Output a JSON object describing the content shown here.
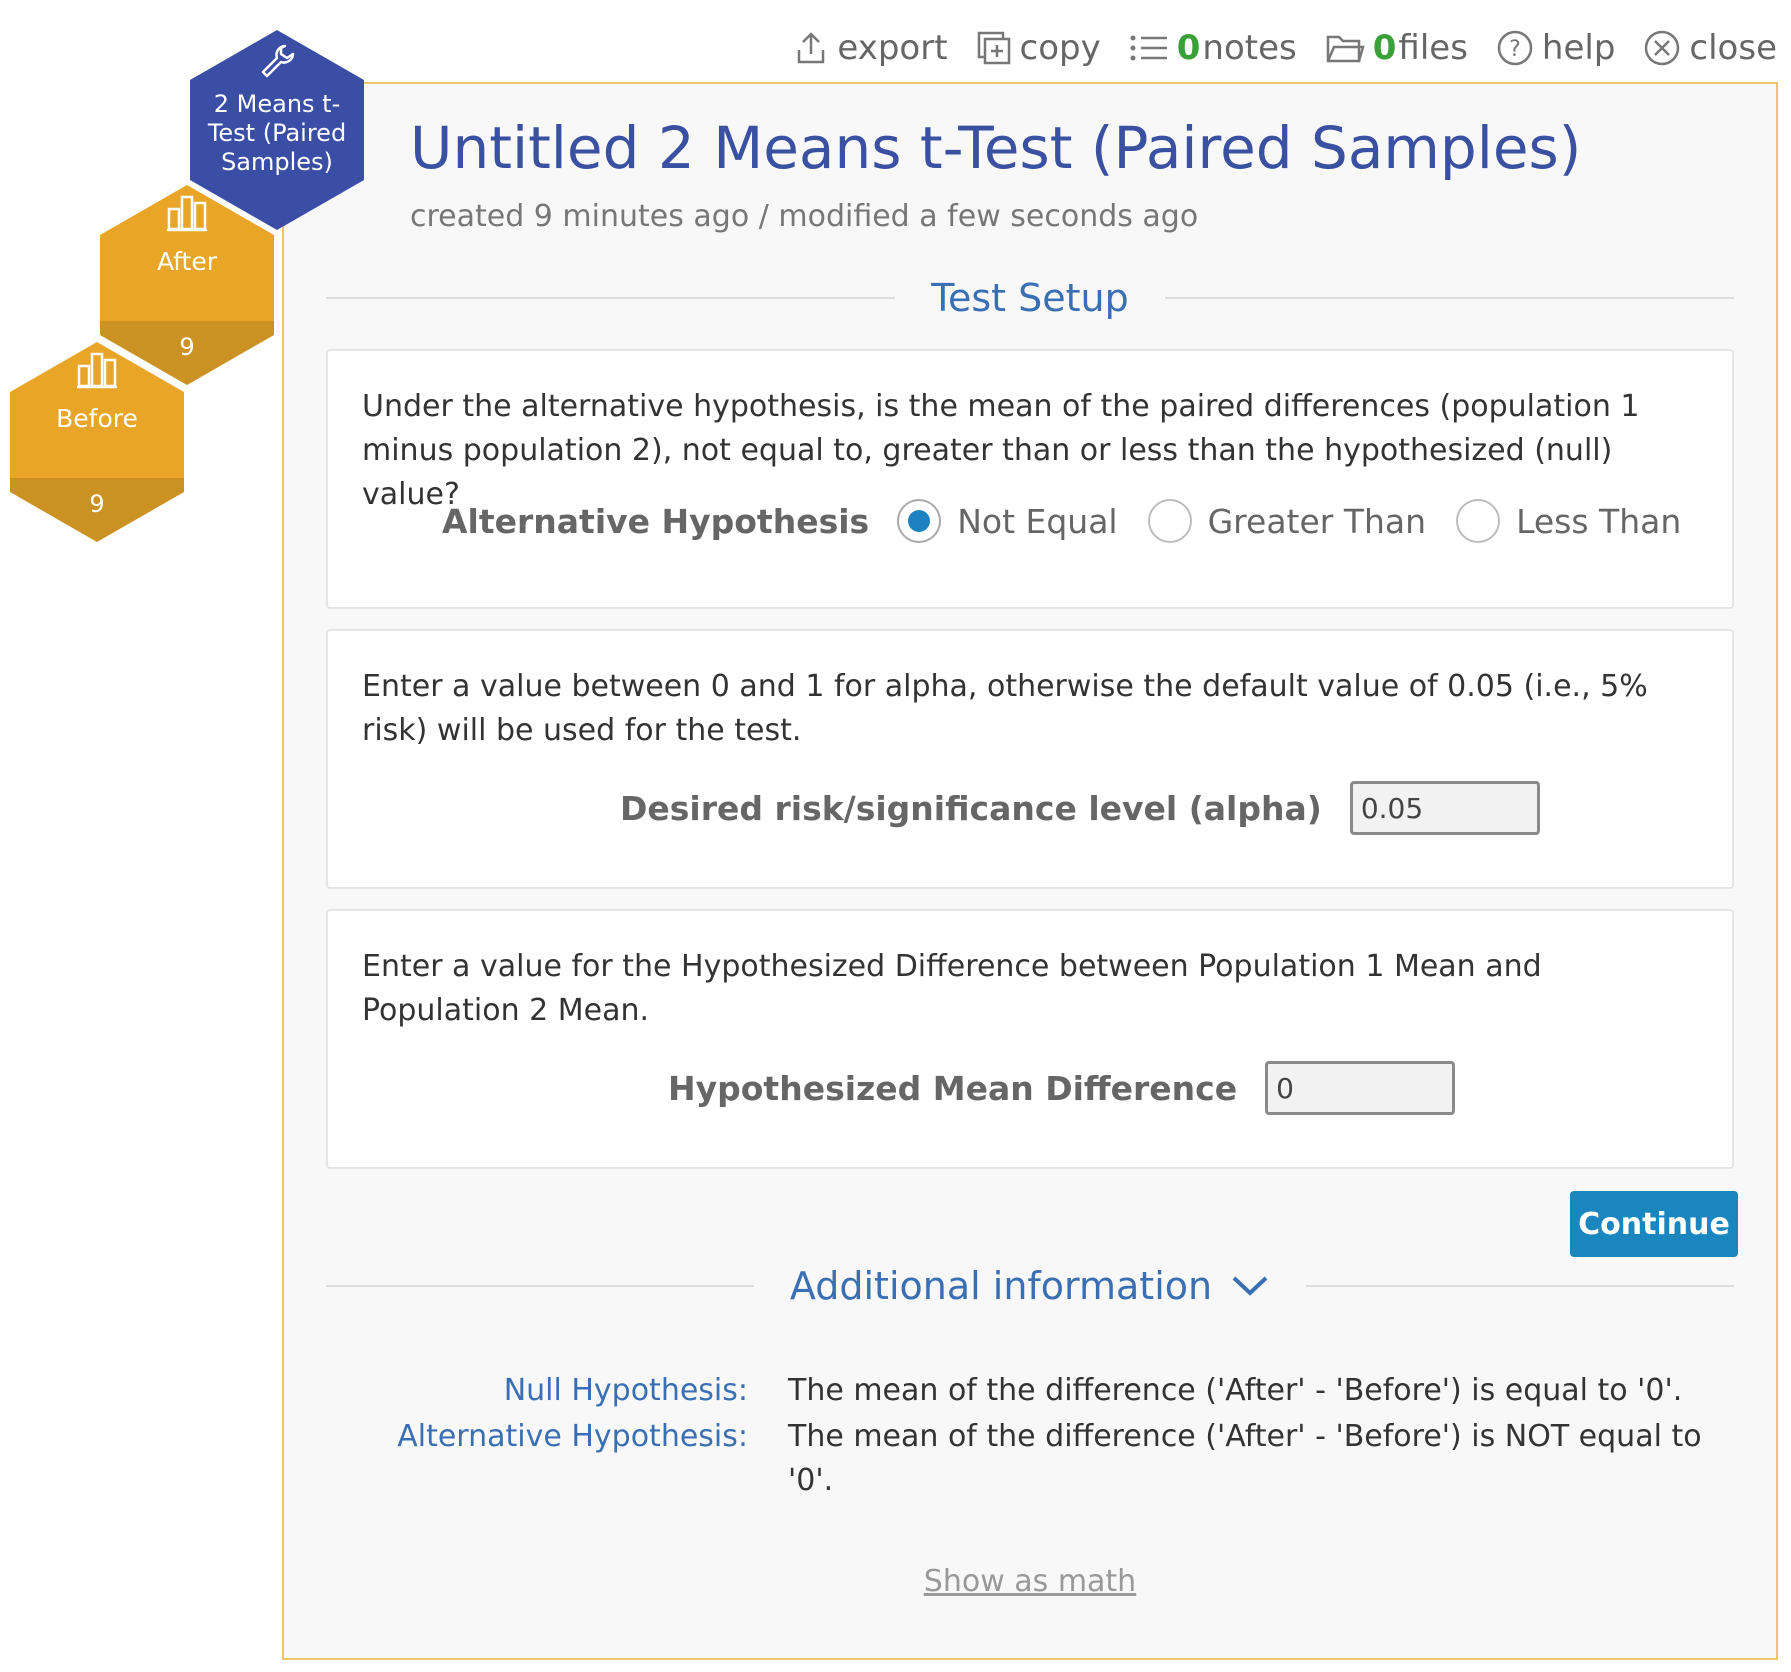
{
  "toolbar": {
    "export_label": "export",
    "copy_label": "copy",
    "notes_count": "0",
    "notes_label": "notes",
    "files_count": "0",
    "files_label": "files",
    "help_label": "help",
    "close_label": "close"
  },
  "nodes": {
    "main_label": "2 Means t-Test (Paired Samples)",
    "after_label": "After",
    "after_count": "9",
    "before_label": "Before",
    "before_count": "9"
  },
  "header": {
    "title": "Untitled 2 Means t-Test (Paired Samples)",
    "subtitle": "created 9 minutes ago / modified a few seconds ago"
  },
  "test_setup": {
    "section_title": "Test Setup",
    "hypothesis_question": "Under the alternative hypothesis, is the mean of the paired differences (population 1 minus population 2), not equal to, greater than or less than the hypothesized (null) value?",
    "alt_hypothesis_label": "Alternative Hypothesis",
    "options": [
      "Not Equal",
      "Greater Than",
      "Less Than"
    ],
    "selected_option": "Not Equal",
    "alpha_description": "Enter a value between 0 and 1 for alpha, otherwise the default value of 0.05 (i.e., 5% risk) will be used for the test.",
    "alpha_label": "Desired risk/significance level (alpha)",
    "alpha_value": "0.05",
    "diff_description": "Enter a value for the Hypothesized Difference between Population 1 Mean and Population 2 Mean.",
    "diff_label": "Hypothesized Mean Difference",
    "diff_value": "0",
    "continue_label": "Continue"
  },
  "additional_info": {
    "section_title": "Additional information",
    "null_label": "Null Hypothesis:",
    "null_text": "The mean of the difference ('After' - 'Before') is equal to '0'.",
    "alt_label": "Alternative Hypothesis:",
    "alt_text": "The mean of the difference ('After' - 'Before') is NOT equal to '0'.",
    "show_math_label": "Show as math"
  },
  "colors": {
    "accent_blue": "#3a50a0",
    "link_blue": "#3a6fb3",
    "button_blue": "#1a86bf",
    "hex_orange": "#e8a528",
    "hex_navy": "#3a4ea6",
    "count_green": "#3aa03a",
    "panel_border": "#f0c46a"
  },
  "icons": [
    "export-icon",
    "copy-icon",
    "notes-icon",
    "files-icon",
    "help-icon",
    "close-icon",
    "wrench-icon",
    "bar-chart-icon",
    "chevron-down-icon"
  ]
}
